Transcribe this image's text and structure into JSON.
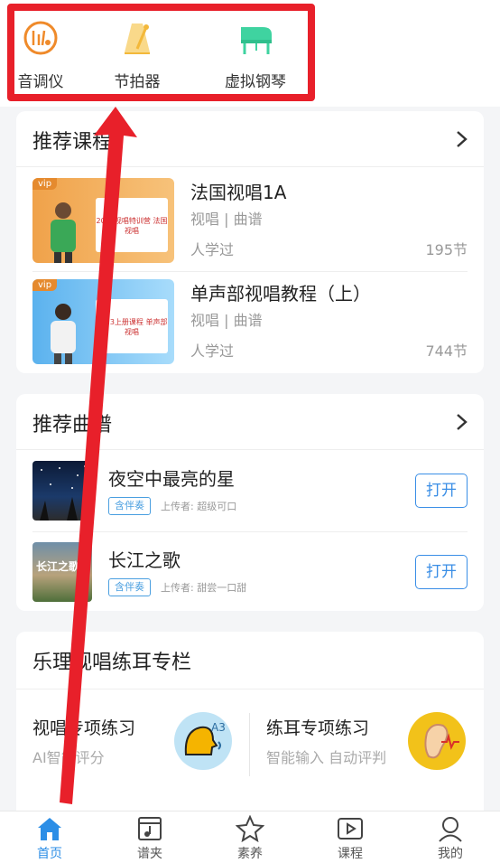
{
  "tools": [
    {
      "label": "音调仪",
      "icon": "tuner-icon"
    },
    {
      "label": "节拍器",
      "icon": "metronome-icon"
    },
    {
      "label": "虚拟钢琴",
      "icon": "piano-icon"
    }
  ],
  "courses": {
    "title": "推荐课程",
    "items": [
      {
        "name": "法国视唱1A",
        "tags": "视唱 | 曲谱",
        "learned": "人学过",
        "count": "195节",
        "badge": "vip",
        "thumb_text": "2023视唱特训营 法国视唱"
      },
      {
        "name": "单声部视唱教程（上）",
        "tags": "视唱 | 曲谱",
        "learned": "人学过",
        "count": "744节",
        "badge": "vip",
        "thumb_text": "2023上册课程 单声部视唱"
      }
    ]
  },
  "sheets": {
    "title": "推荐曲谱",
    "items": [
      {
        "name": "夜空中最亮的星",
        "badge": "含伴奏",
        "uploader": "上传者: 超级可口",
        "action": "打开"
      },
      {
        "name": "长江之歌",
        "badge": "含伴奏",
        "uploader": "上传者: 甜尝一口甜",
        "action": "打开",
        "img_text": "长江之歌"
      }
    ]
  },
  "theory": {
    "title": "乐理视唱练耳专栏",
    "items": [
      {
        "title": "视唱专项练习",
        "sub": "AI智能评分",
        "icon": "singing-head-icon"
      },
      {
        "title": "练耳专项练习",
        "sub": "智能输入 自动评判",
        "icon": "ear-icon"
      }
    ]
  },
  "nav": [
    {
      "label": "首页",
      "icon": "home-icon",
      "active": true
    },
    {
      "label": "谱夹",
      "icon": "sheet-folder-icon",
      "active": false
    },
    {
      "label": "素养",
      "icon": "star-icon",
      "active": false
    },
    {
      "label": "课程",
      "icon": "play-video-icon",
      "active": false
    },
    {
      "label": "我的",
      "icon": "profile-icon",
      "active": false
    }
  ],
  "colors": {
    "accent_blue": "#2c8ee6",
    "annotation_red": "#e8202a",
    "tuner_orange": "#ef8a2a",
    "metronome_yellow": "#f3b83a",
    "piano_green": "#3fd3a0"
  }
}
